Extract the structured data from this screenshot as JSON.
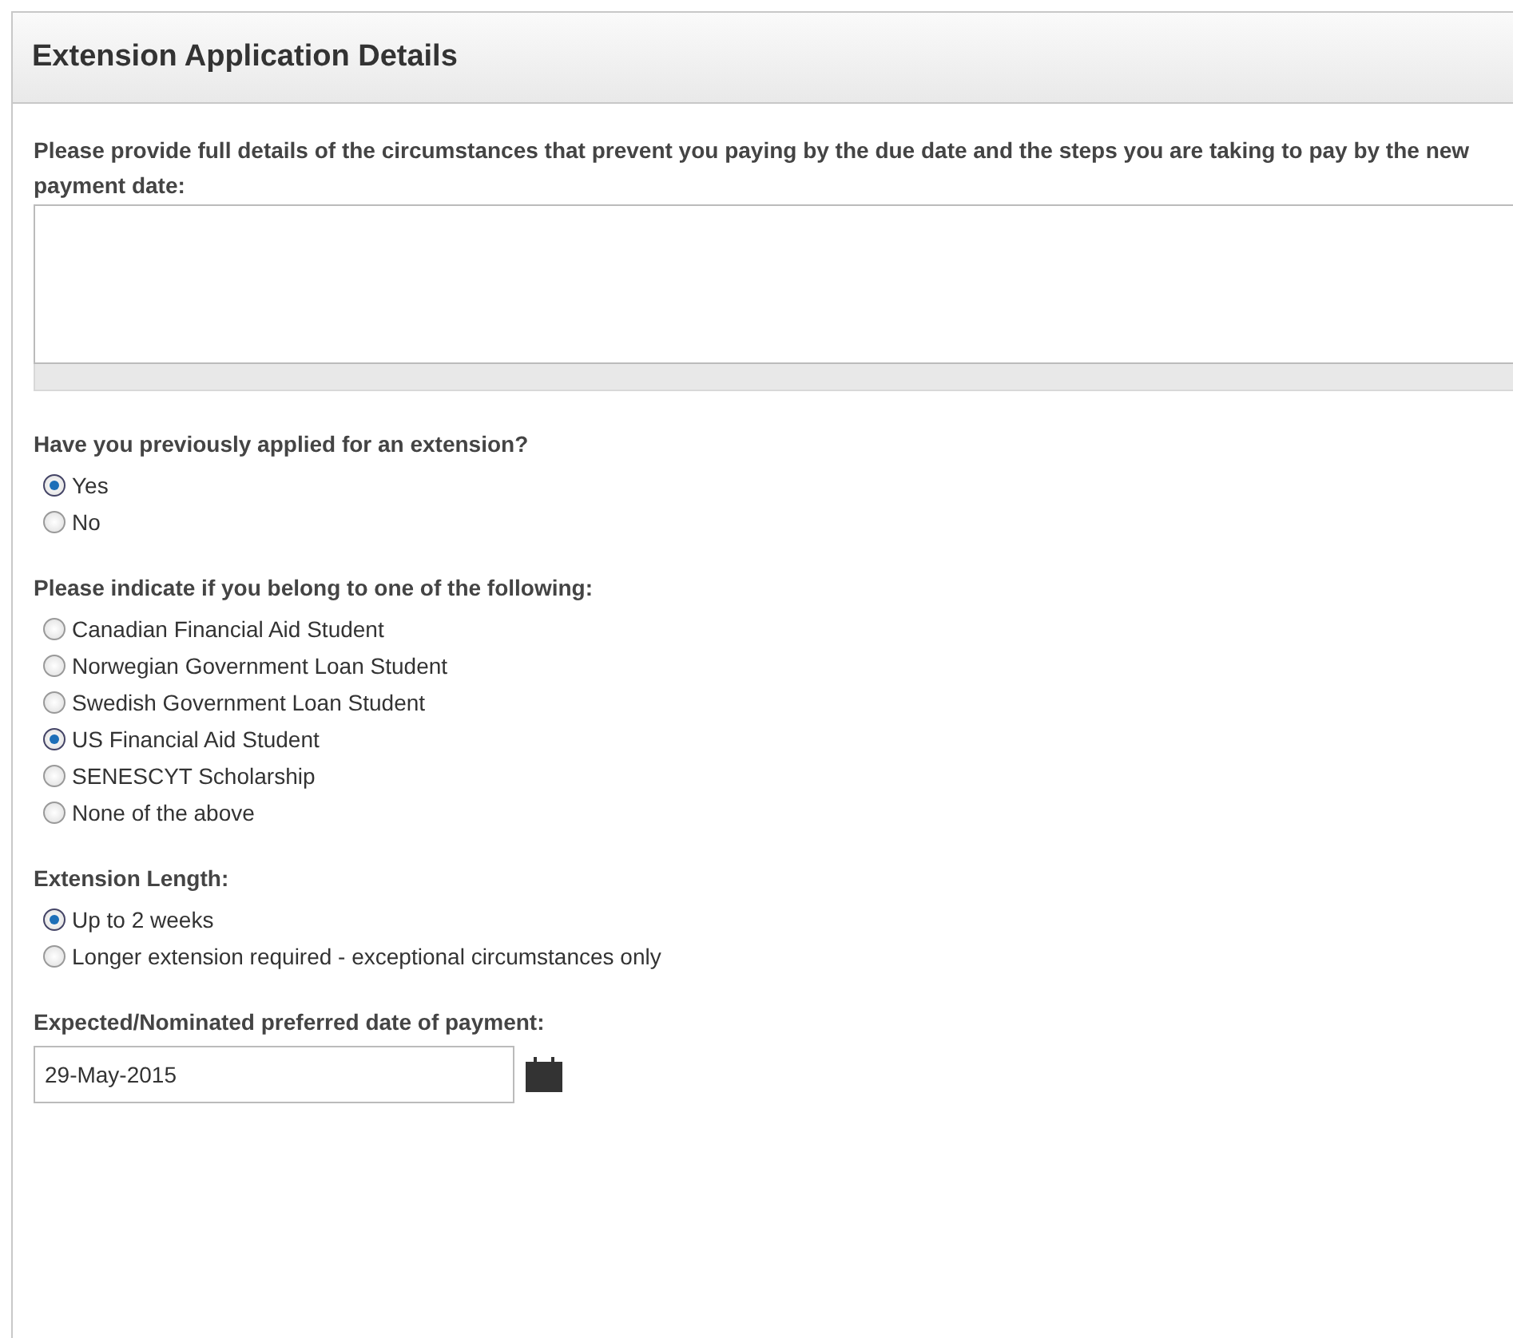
{
  "panel": {
    "title": "Extension Application Details"
  },
  "sections": [
    {
      "kind": "textarea",
      "label": "Please provide full details of the circumstances that prevent you paying by the due date and the steps you are taking to pay by the new payment date:"
    },
    {
      "kind": "radio",
      "label": "Have you previously applied for an extension?",
      "options": [
        {
          "label": "Yes",
          "selected": true
        },
        {
          "label": "No",
          "selected": false
        }
      ]
    },
    {
      "kind": "radio",
      "label": "Please indicate if you belong to one of the following:",
      "options": [
        {
          "label": "Canadian Financial Aid Student",
          "selected": false
        },
        {
          "label": "Norwegian Government Loan Student",
          "selected": false
        },
        {
          "label": "Swedish Government Loan Student",
          "selected": false
        },
        {
          "label": "US Financial Aid Student",
          "selected": true
        },
        {
          "label": "SENESCYT Scholarship",
          "selected": false
        },
        {
          "label": "None of the above",
          "selected": false
        }
      ]
    },
    {
      "kind": "radio",
      "label": "Extension Length:",
      "options": [
        {
          "label": "Up to 2 weeks",
          "selected": true
        },
        {
          "label": "Longer extension required - exceptional circumstances only",
          "selected": false
        }
      ]
    },
    {
      "kind": "date",
      "label": "Expected/Nominated preferred date of payment:",
      "value": "29-May-2015"
    }
  ]
}
